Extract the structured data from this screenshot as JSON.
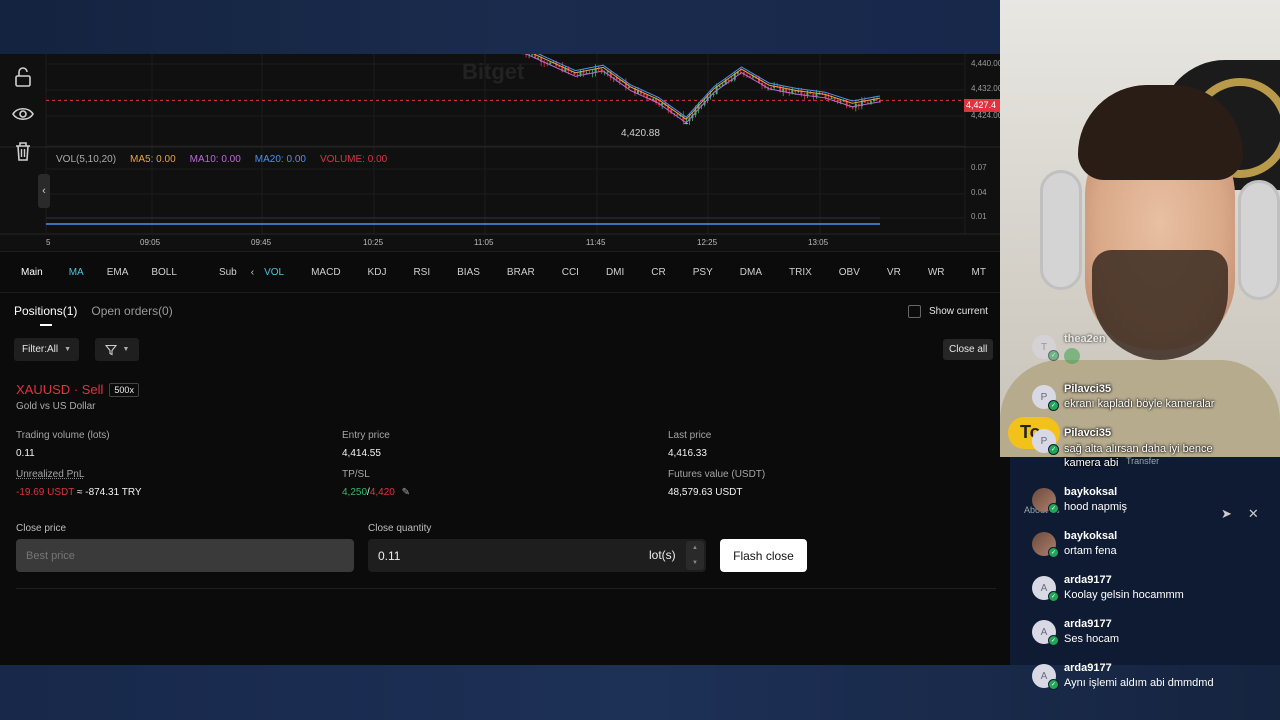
{
  "chart": {
    "axis_prices": [
      "4,440.00",
      "4,432.00",
      "4,424.00"
    ],
    "current_price_tag": "4,427.4",
    "low_label": "4,420.88",
    "watermark": "Bitget",
    "vol_axis": [
      "0.07",
      "0.04",
      "0.01"
    ],
    "time_labels": [
      "5",
      "09:05",
      "09:45",
      "10:25",
      "11:05",
      "11:45",
      "12:25",
      "13:05"
    ],
    "vol_legend": {
      "title": "VOL(5,10,20)",
      "ma5": "MA5: 0.00",
      "ma10": "MA10: 0.00",
      "ma20": "MA20: 0.00",
      "volume": "VOLUME: 0.00"
    },
    "colors": {
      "up": "#3cb46a",
      "down": "#e0323f",
      "ma5": "#e8a444",
      "ma10": "#b86ad8",
      "ma20": "#4a90f0"
    },
    "chart_data": {
      "type": "line",
      "x": [
        "11:05",
        "11:15",
        "11:25",
        "11:35",
        "11:45",
        "11:55",
        "12:05",
        "12:15",
        "12:25",
        "12:35",
        "12:45",
        "12:55",
        "13:05",
        "13:15"
      ],
      "series": [
        {
          "values": [
            4441.5,
            4438.0,
            4434.5,
            4436.0,
            4430.5,
            4427.0,
            4421.5,
            4430.0,
            4435.5,
            4431.0,
            4429.5,
            4428.5,
            4426.0,
            4427.4
          ]
        }
      ],
      "ylim": [
        4418,
        4442
      ]
    }
  },
  "indicators": {
    "main_label": "Main",
    "main_items": [
      "MA",
      "EMA",
      "BOLL"
    ],
    "sub_label": "Sub",
    "sub_items": [
      "VOL",
      "MACD",
      "KDJ",
      "RSI",
      "BIAS",
      "BRAR",
      "CCI",
      "DMI",
      "CR",
      "PSY",
      "DMA",
      "TRIX",
      "OBV",
      "VR",
      "WR",
      "MT"
    ]
  },
  "positions": {
    "tab_positions": "Positions(1)",
    "tab_orders": "Open orders(0)",
    "show_current": "Show current",
    "filter_label": "Filter:All",
    "close_all": "Close all",
    "symbol": "XAUUSD · Sell",
    "leverage": "500x",
    "symbol_sub": "Gold vs US Dollar",
    "fields": {
      "volume_label": "Trading volume (lots)",
      "volume_value": "0.11",
      "entry_label": "Entry price",
      "entry_value": "4,414.55",
      "last_label": "Last price",
      "last_value": "4,416.33",
      "pnl_label": "Unrealized PnL",
      "pnl_value": "-19.69 USDT",
      "pnl_try": " ≈ -874.31 TRY",
      "tpsl_label": "TP/SL",
      "tp_value": "4,250",
      "sl_value": "4,420",
      "futures_label": "Futures value (USDT)",
      "futures_value": "48,579.63 USDT"
    },
    "close_price_label": "Close price",
    "close_price_placeholder": "Best price",
    "close_qty_label": "Close quantity",
    "close_qty_value": "0.11",
    "close_qty_unit": "lot(s)",
    "flash_close": "Flash close"
  },
  "stream": {
    "bubble_text": "To",
    "ghost_transfer": "Transfer",
    "ghost_about": "About us",
    "chat": [
      {
        "user": "thea2en",
        "text": "",
        "avatar": "T"
      },
      {
        "user": "Pilavci35",
        "text": "ekranı kapladı böyle kameralar",
        "avatar": "P"
      },
      {
        "user": "Pilavci35",
        "text": "sağ alta alırsan daha iyi bence kamera abi",
        "avatar": "P"
      },
      {
        "user": "baykoksal",
        "text": "hood napmiş",
        "avatar": ""
      },
      {
        "user": "baykoksal",
        "text": "ortam fena",
        "avatar": ""
      },
      {
        "user": "arda9177",
        "text": "Koolay gelsin hocammm",
        "avatar": "A"
      },
      {
        "user": "arda9177",
        "text": "Ses hocam",
        "avatar": "A"
      },
      {
        "user": "arda9177",
        "text": "Aynı işlemi aldım abi dmmdmd",
        "avatar": "A"
      }
    ]
  }
}
